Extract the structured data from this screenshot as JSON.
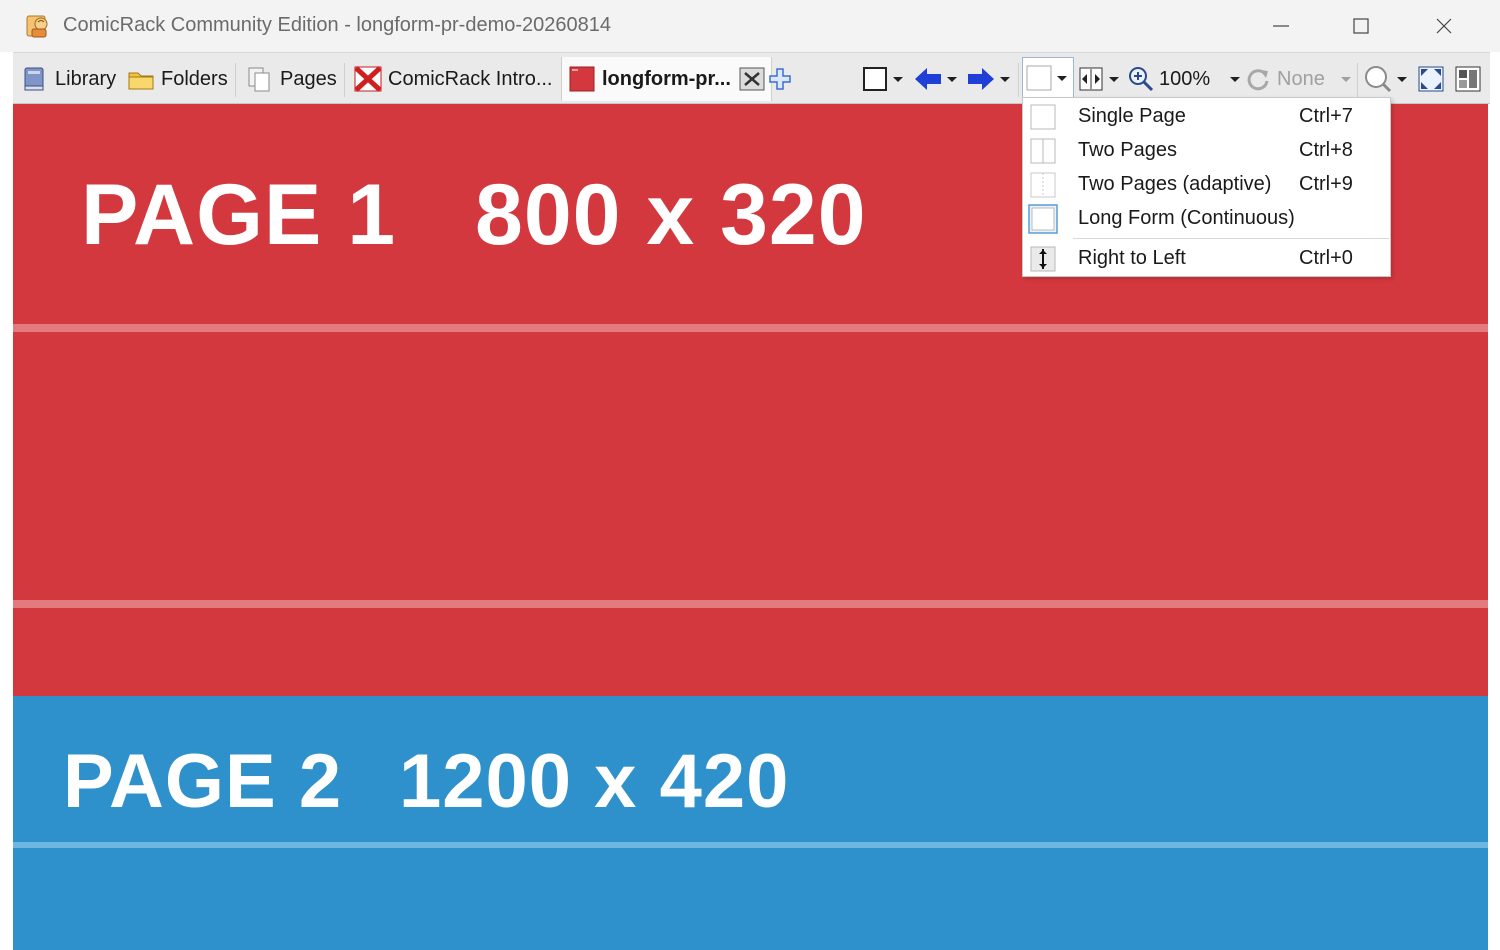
{
  "window": {
    "title": "ComicRack Community Edition - longform-pr-demo-20260814"
  },
  "tabs": [
    {
      "label": "Library",
      "icon": "library-icon"
    },
    {
      "label": "Folders",
      "icon": "folder-icon"
    },
    {
      "label": "Pages",
      "icon": "pages-icon"
    },
    {
      "label": "ComicRack Intro...",
      "icon": "comic-cover-icon"
    },
    {
      "label": "longform-pr...",
      "icon": "comic-cover-icon",
      "active": true
    }
  ],
  "toolbar": {
    "zoom": "100%",
    "rotation": "None"
  },
  "view_menu": {
    "items": [
      {
        "label": "Single Page",
        "shortcut": "Ctrl+7"
      },
      {
        "label": "Two Pages",
        "shortcut": "Ctrl+8"
      },
      {
        "label": "Two Pages (adaptive)",
        "shortcut": "Ctrl+9"
      },
      {
        "label": "Long Form (Continuous)",
        "shortcut": "",
        "checked": true
      },
      {
        "label": "Right to Left",
        "shortcut": "Ctrl+0"
      }
    ]
  },
  "pages": [
    {
      "label": "PAGE 1",
      "dimensions": "800 x 320",
      "color": "#d3383e"
    },
    {
      "label": "PAGE 2",
      "dimensions": "1200 x 420",
      "color": "#2f91cc"
    }
  ],
  "colors": {
    "titlebar": "#f3f3f3",
    "toolbar": "#eaeaea",
    "accent_blue": "#1f3fd6"
  }
}
